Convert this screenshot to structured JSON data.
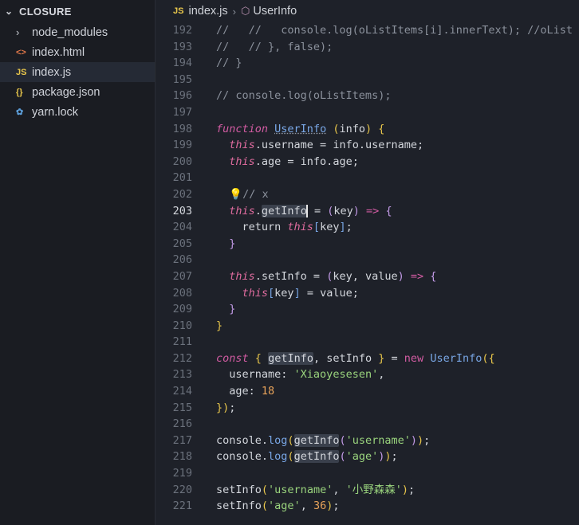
{
  "sidebar": {
    "title": "CLOSURE",
    "items": [
      {
        "label": "node_modules",
        "icon": ">"
      },
      {
        "label": "index.html",
        "icon": "<>"
      },
      {
        "label": "index.js",
        "icon": "JS"
      },
      {
        "label": "package.json",
        "icon": "{}"
      },
      {
        "label": "yarn.lock",
        "icon": "yarn"
      }
    ]
  },
  "breadcrumb": {
    "file_badge": "JS",
    "file": "index.js",
    "symbol": "UserInfo"
  },
  "editor": {
    "line_numbers": [
      "192",
      "193",
      "194",
      "195",
      "196",
      "197",
      "198",
      "199",
      "200",
      "201",
      "202",
      "203",
      "204",
      "205",
      "206",
      "207",
      "208",
      "209",
      "210",
      "211",
      "212",
      "213",
      "214",
      "215",
      "216",
      "217",
      "218",
      "219",
      "220",
      "221"
    ]
  },
  "colors": {
    "keyword": "#d35ca3",
    "function": "#79a7e6",
    "string": "#9ad47d",
    "number": "#e8a35a",
    "comment": "#8b919c"
  }
}
